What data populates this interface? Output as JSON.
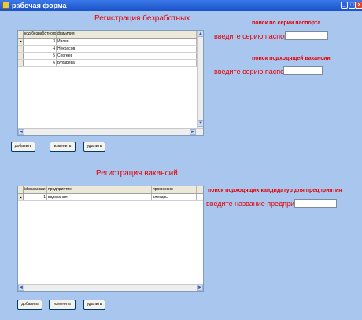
{
  "window": {
    "title": "рабочая форма"
  },
  "section_unemployed": {
    "heading": "Регистрация безработных",
    "columns": [
      "код безработного",
      "фамилия"
    ],
    "rows": [
      {
        "id": "3",
        "surname": "Ивлев"
      },
      {
        "id": "4",
        "surname": "Некрасов"
      },
      {
        "id": "5",
        "surname": "Сергеев"
      },
      {
        "id": "6",
        "surname": "Бухарева"
      }
    ],
    "buttons": {
      "add": "добавить",
      "edit": "изменить",
      "delete": "удалить"
    }
  },
  "search_passport": {
    "title": "поиск по серии паспорта",
    "label": "введите серию паспорта",
    "value": ""
  },
  "search_vacancy": {
    "title": "поиск подходящей вакансии",
    "label": "введите серию паспорта",
    "value": ""
  },
  "section_vacancies": {
    "heading": "Регистрация вакансий",
    "columns": [
      "id вакансии",
      "предприятие",
      "профессия"
    ],
    "rows": [
      {
        "id": "1",
        "company": "водоканал",
        "profession": "слесарь"
      }
    ],
    "buttons": {
      "add": "добавить",
      "edit": "изменить",
      "delete": "удалить"
    }
  },
  "search_candidates": {
    "title": "поиск подходящих кандидатур для предприятия",
    "label": "введите название предприятия",
    "value": ""
  },
  "scroll_glyphs": {
    "up": "▲",
    "down": "▼",
    "left": "◄",
    "right": "►"
  },
  "colors": {
    "background": "#a9c6ef",
    "accent_red": "#e60000",
    "titlebar": "#1b52c9"
  }
}
